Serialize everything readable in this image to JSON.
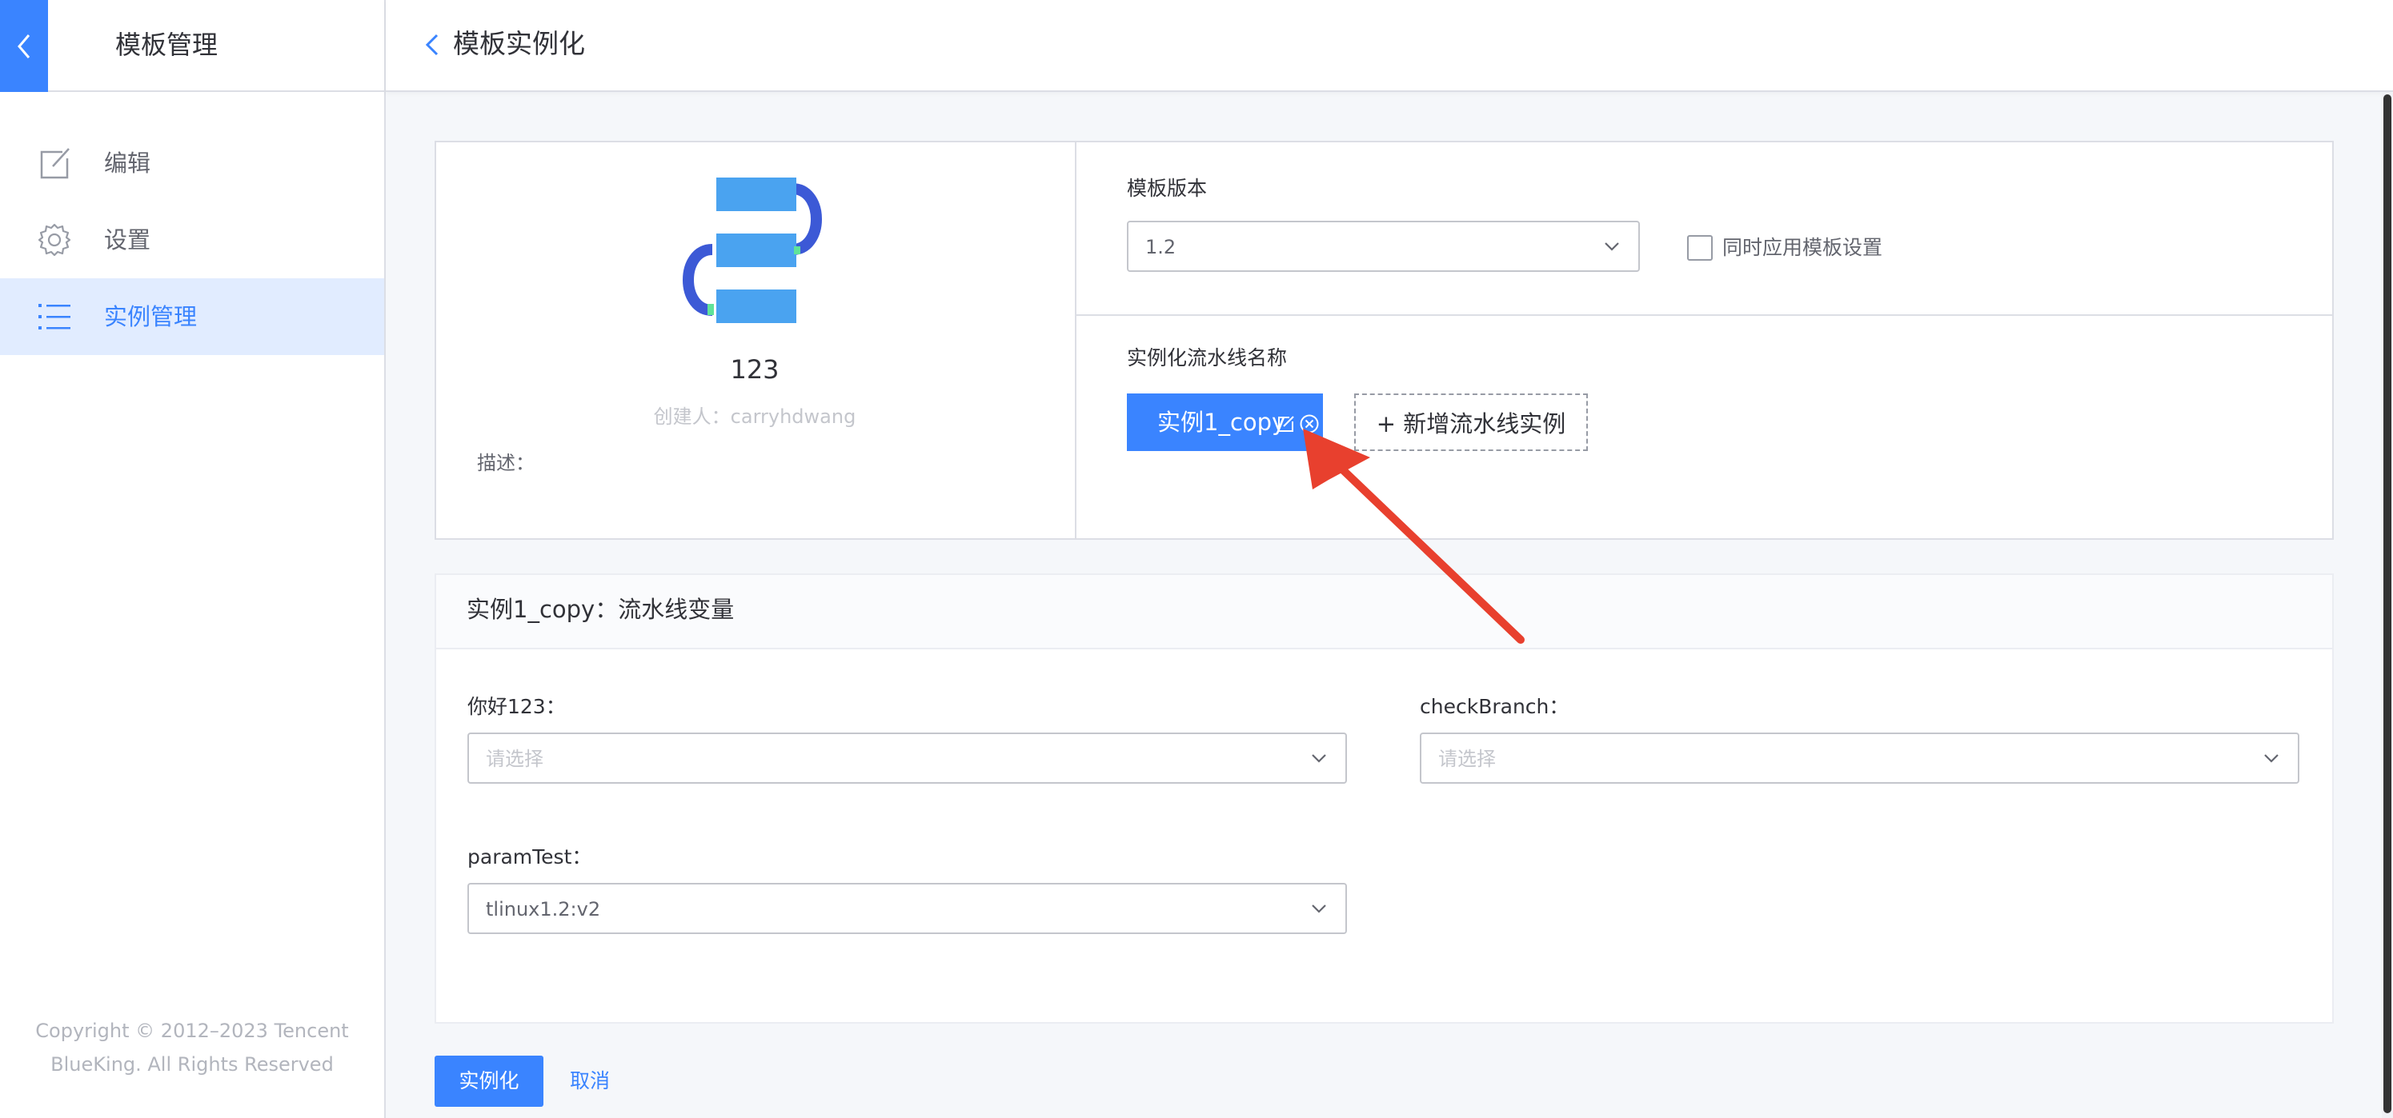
{
  "sidebar": {
    "title": "模板管理",
    "back_icon": "chevron-left-icon",
    "items": [
      {
        "label": "编辑",
        "icon": "edit-icon",
        "active": false
      },
      {
        "label": "设置",
        "icon": "gear-icon",
        "active": false
      },
      {
        "label": "实例管理",
        "icon": "list-icon",
        "active": true
      }
    ],
    "copyright_line1": "Copyright © 2012–2023 Tencent",
    "copyright_line2": "BlueKing. All Rights Reserved"
  },
  "header": {
    "title": "模板实例化",
    "back_icon": "chevron-left-icon"
  },
  "template_info": {
    "name": "123",
    "creator": "创建人：carryhdwang",
    "description_label": "描述："
  },
  "version": {
    "label": "模板版本",
    "value": "1.2",
    "apply_settings_label": "同时应用模板设置",
    "apply_settings_checked": false
  },
  "instances": {
    "label": "实例化流水线名称",
    "selected_instance": "实例1_copy",
    "add_button": "+ 新增流水线实例"
  },
  "variables": {
    "title": "实例1_copy：流水线变量",
    "fields": [
      {
        "label": "你好123：",
        "value": "",
        "placeholder": "请选择"
      },
      {
        "label": "checkBranch：",
        "value": "",
        "placeholder": "请选择"
      },
      {
        "label": "paramTest：",
        "value": "tlinux1.2:v2",
        "placeholder": ""
      }
    ]
  },
  "footer": {
    "submit_label": "实例化",
    "cancel_label": "取消"
  },
  "colors": {
    "primary": "#3a84ff",
    "active_bg": "#e1ecff",
    "annotation_arrow": "#e8402e"
  }
}
